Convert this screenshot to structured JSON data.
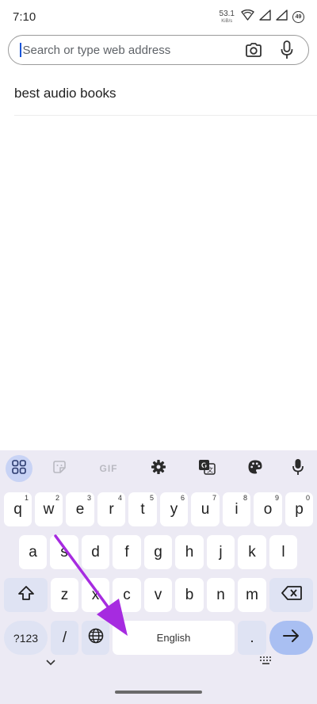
{
  "status": {
    "time": "7:10",
    "net_value": "53.1",
    "net_unit": "KiB/s",
    "battery": "49"
  },
  "search": {
    "placeholder": "Search or type web address"
  },
  "suggestions": [
    {
      "text": "best audio books"
    }
  ],
  "keyboard": {
    "toolbar": {
      "gif_label": "GIF"
    },
    "row1": [
      {
        "key": "q",
        "hint": "1"
      },
      {
        "key": "w",
        "hint": "2"
      },
      {
        "key": "e",
        "hint": "3"
      },
      {
        "key": "r",
        "hint": "4"
      },
      {
        "key": "t",
        "hint": "5"
      },
      {
        "key": "y",
        "hint": "6"
      },
      {
        "key": "u",
        "hint": "7"
      },
      {
        "key": "i",
        "hint": "8"
      },
      {
        "key": "o",
        "hint": "9"
      },
      {
        "key": "p",
        "hint": "0"
      }
    ],
    "row2": [
      "a",
      "s",
      "d",
      "f",
      "g",
      "h",
      "j",
      "k",
      "l"
    ],
    "row3": [
      "z",
      "x",
      "c",
      "v",
      "b",
      "n",
      "m"
    ],
    "row4": {
      "symbols": "?123",
      "slash": "/",
      "space": "English",
      "period": "."
    }
  },
  "colors": {
    "accent": "#1a55d8",
    "keyboard_bg": "#eceaf4",
    "action_key": "#a9bff2",
    "arrow_annotation": "#a62be0"
  }
}
